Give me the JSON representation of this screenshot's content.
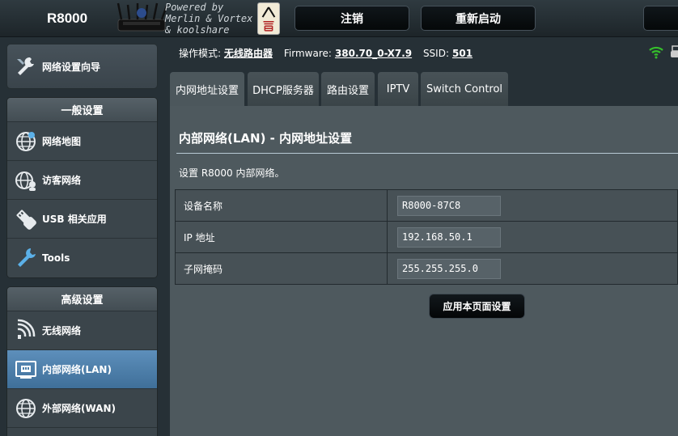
{
  "header": {
    "model": "R8000",
    "powered_by": [
      "Powered by",
      "Merlin & Vortex",
      "& koolshare"
    ],
    "logout_label": "注销",
    "reboot_label": "重新启动"
  },
  "sidebar": {
    "wizard_label": "网络设置向导",
    "general": {
      "title": "一般设置",
      "items": [
        {
          "label": "网络地图",
          "icon": "globe-icon"
        },
        {
          "label": "访客网络",
          "icon": "guest-globe-icon"
        },
        {
          "label": "USB 相关应用",
          "icon": "usb-icon"
        },
        {
          "label": "Tools",
          "icon": "wrench-icon"
        }
      ]
    },
    "advanced": {
      "title": "高级设置",
      "items": [
        {
          "label": "无线网络",
          "icon": "wireless-icon"
        },
        {
          "label": "内部网络(LAN)",
          "icon": "lan-icon",
          "active": true
        },
        {
          "label": "外部网络(WAN)",
          "icon": "wan-globe-icon"
        }
      ]
    }
  },
  "status": {
    "mode_label": "操作模式:",
    "mode_value": "无线路由器",
    "fw_label": "Firmware:",
    "fw_value": "380.70_0-X7.9",
    "ssid_label": "SSID:",
    "ssid_value": "501"
  },
  "tabs": [
    {
      "label": "内网地址设置",
      "active": true
    },
    {
      "label": "DHCP服务器"
    },
    {
      "label": "路由设置"
    },
    {
      "label": "IPTV"
    },
    {
      "label": "Switch Control"
    }
  ],
  "main": {
    "title": "内部网络(LAN) - 内网地址设置",
    "description": "设置 R8000 内部网络。",
    "rows": [
      {
        "label": "设备名称",
        "value": "R8000-87C8"
      },
      {
        "label": "IP 地址",
        "value": "192.168.50.1"
      },
      {
        "label": "子网掩码",
        "value": "255.255.255.0"
      }
    ],
    "apply_label": "应用本页面设置"
  },
  "colors": {
    "active_nav": "#4b7fab",
    "wifi_green": "#35c02b",
    "panel_bg": "#4e595e"
  }
}
